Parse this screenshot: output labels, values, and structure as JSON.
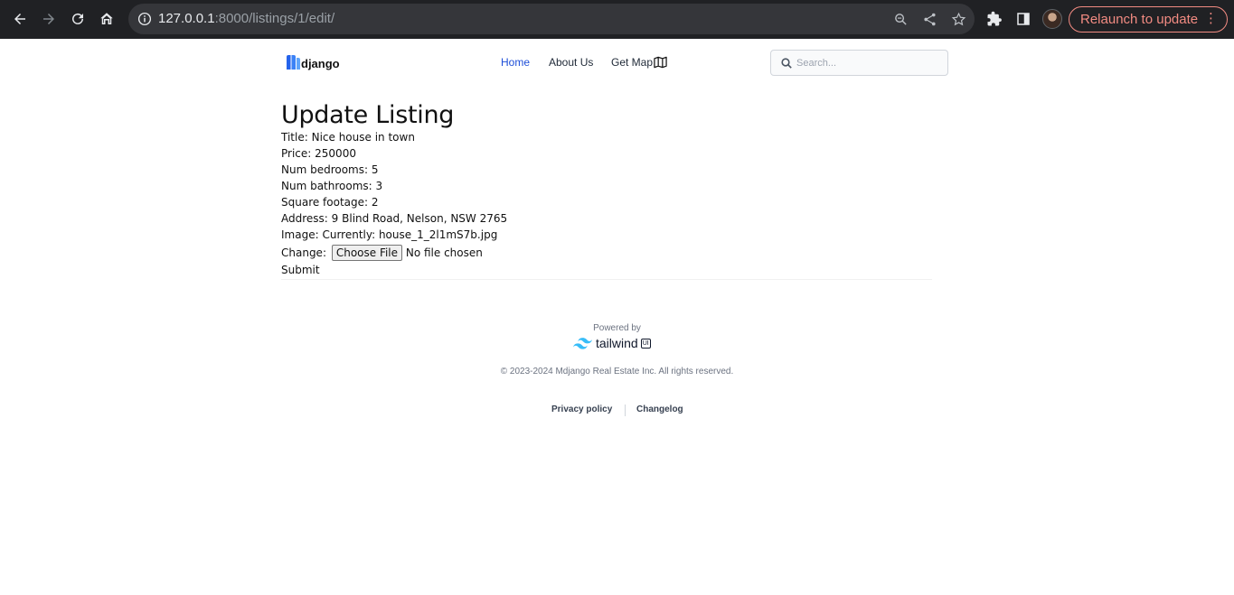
{
  "browser": {
    "url_host": "127.0.0.1",
    "url_rest": ":8000/listings/1/edit/",
    "relaunch_label": "Relaunch to update",
    "icons": [
      "back-icon",
      "forward-icon",
      "reload-icon",
      "home-icon",
      "info-icon",
      "zoom-icon",
      "share-icon",
      "star-icon",
      "extensions-icon",
      "side-panel-icon",
      "profile-avatar",
      "more-icon"
    ]
  },
  "header": {
    "logo_text": "django",
    "nav": [
      {
        "label": "Home",
        "active": true
      },
      {
        "label": "About Us",
        "active": false
      },
      {
        "label": "Get Map",
        "active": false
      }
    ],
    "search_placeholder": "Search..."
  },
  "form": {
    "heading": "Update Listing",
    "fields": [
      {
        "label": "Title:",
        "value": "Nice house in town"
      },
      {
        "label": "Price:",
        "value": "250000"
      },
      {
        "label": "Num bedrooms:",
        "value": "5"
      },
      {
        "label": "Num bathrooms:",
        "value": "3"
      },
      {
        "label": "Square footage:",
        "value": "2"
      },
      {
        "label": "Address:",
        "value": "9 Blind Road, Nelson, NSW 2765"
      }
    ],
    "image_label": "Image:",
    "image_current": "Currently: house_1_2l1mS7b.jpg",
    "change_label": "Change:",
    "choose_file_label": "Choose File",
    "no_file_text": "No file chosen",
    "submit_label": "Submit"
  },
  "footer": {
    "powered_by": "Powered by",
    "tailwind_word": "tailwind",
    "tailwind_badge": "UI",
    "copyright": "© 2023-2024 Mdjango Real Estate Inc. All rights reserved.",
    "links": [
      "Privacy policy",
      "Changelog"
    ]
  },
  "colors": {
    "chrome_bg": "#202124",
    "omnibox_bg": "#35363a",
    "relaunch": "#f28b82",
    "nav_active": "#1d4ed8",
    "logo_blue": "#2563eb",
    "tailwind_cyan": "#38bdf8"
  }
}
